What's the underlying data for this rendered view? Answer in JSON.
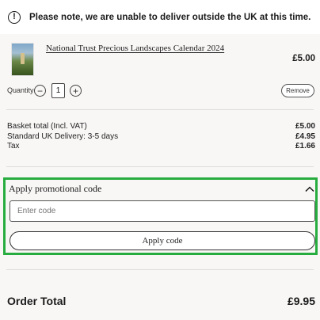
{
  "notice": {
    "icon": "exclamation-icon",
    "message": "Please note, we are unable to deliver outside the UK at this time."
  },
  "product": {
    "title": "National Trust Precious Landscapes Calendar 2024",
    "price": "£5.00",
    "quantity_label": "Quantity",
    "quantity_value": "1",
    "minus_icon": "minus-icon",
    "plus_icon": "plus-icon",
    "minus_glyph": "−",
    "plus_glyph": "+",
    "remove_label": "Remove"
  },
  "totals": {
    "rows": [
      {
        "label": "Basket total (Incl. VAT)",
        "value": "£5.00"
      },
      {
        "label": "Standard UK Delivery: 3-5 days",
        "value": "£4.95"
      },
      {
        "label": "Tax",
        "value": "£1.66"
      }
    ]
  },
  "promo": {
    "title": "Apply promotional code",
    "chevron_icon": "chevron-up-icon",
    "input_placeholder": "Enter code",
    "input_value": "",
    "apply_label": "Apply code",
    "highlight_color": "#27ad3f"
  },
  "order_total": {
    "label": "Order Total",
    "value": "£9.95"
  }
}
